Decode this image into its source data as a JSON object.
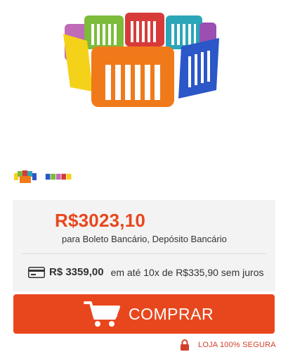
{
  "product": {
    "image_icon": "colorful-play-yard-image",
    "thumbnails": [
      {
        "icon": "play-yard-thumbnail-1"
      },
      {
        "icon": "play-yard-thumbnail-2"
      }
    ]
  },
  "pricing": {
    "main_price": "R$3023,10",
    "payment_methods": "para Boleto Bancário, Depósito Bancário",
    "installment_price": "R$ 3359,00",
    "installment_terms": "em até 10x de R$335,90 sem juros",
    "card_icon": "credit-card-icon"
  },
  "buy_button": {
    "label": "COMPRAR",
    "icon": "cart-icon"
  },
  "security": {
    "text": "LOJA 100% SEGURA",
    "icon": "lock-icon"
  },
  "colors": {
    "accent": "#e8471d",
    "price_box_bg": "#f3f3f3",
    "secure_text": "#d0402a"
  }
}
